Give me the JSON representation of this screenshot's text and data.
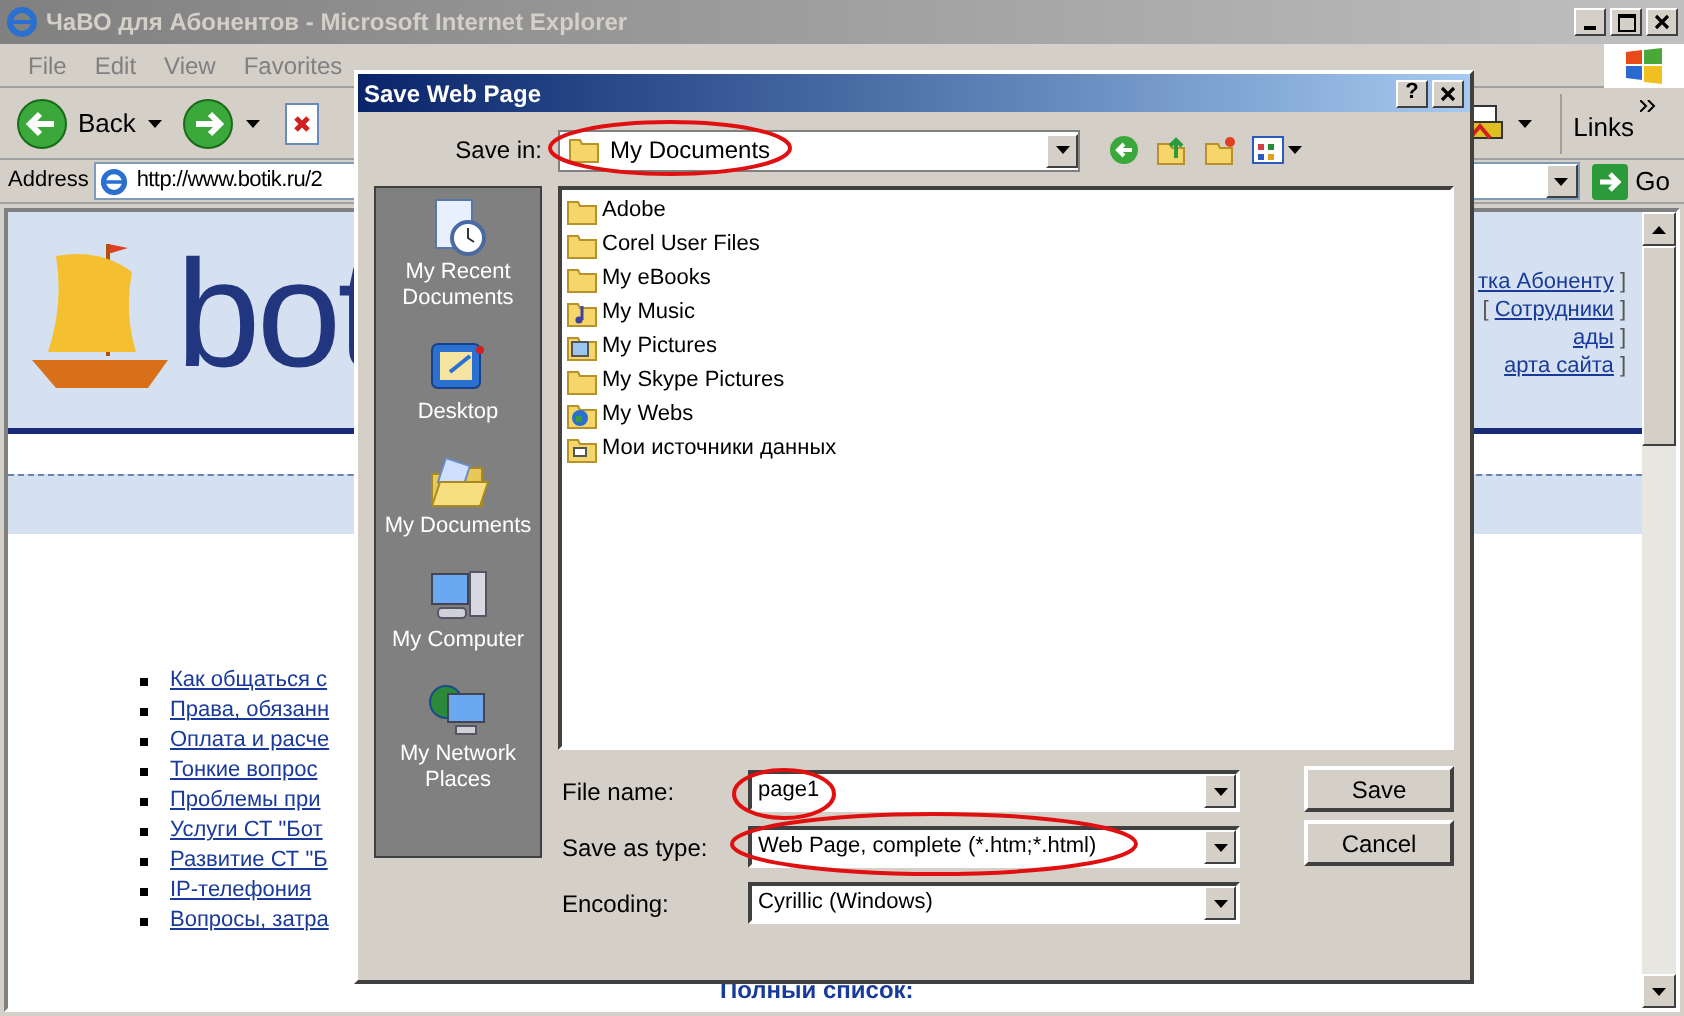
{
  "browser": {
    "title": "ЧаВО для Абонентов - Microsoft Internet Explorer",
    "menu": [
      "File",
      "Edit",
      "View",
      "Favorites"
    ],
    "toolbar": {
      "back": "Back",
      "links": "Links",
      "address_label": "Address",
      "address": "http://www.botik.ru/2",
      "go": "Go"
    }
  },
  "page": {
    "logo_text": "bot",
    "nav_lines": [
      [
        {
          "kind": "link",
          "text": "тка Абоненту"
        },
        {
          "kind": "plain",
          "text": "]"
        }
      ],
      [
        {
          "kind": "plain",
          "text": "["
        },
        {
          "kind": "link",
          "text": "Сотрудники"
        },
        {
          "kind": "plain",
          "text": "]"
        }
      ],
      [
        {
          "kind": "link",
          "text": "ады"
        },
        {
          "kind": "plain",
          "text": "]"
        }
      ],
      [
        {
          "kind": "link",
          "text": "арта сайта"
        },
        {
          "kind": "plain",
          "text": "]"
        }
      ]
    ],
    "faq": [
      "Как общаться с",
      "Права, обязанн",
      "Оплата и расче",
      "Тонкие вопрос",
      "Проблемы при",
      "Услуги СТ \"Бот",
      "Развитие СТ \"Б",
      "IP-телефония",
      "Вопросы, затра"
    ],
    "full_list": "Полный список:"
  },
  "dialog": {
    "title": "Save Web Page",
    "help": "?",
    "save_in_label": "Save in:",
    "save_in": "My Documents",
    "places": [
      {
        "kind": "recent",
        "label": "My Recent Documents"
      },
      {
        "kind": "desktop",
        "label": "Desktop"
      },
      {
        "kind": "documents",
        "label": "My Documents"
      },
      {
        "kind": "computer",
        "label": "My Computer"
      },
      {
        "kind": "network",
        "label": "My Network Places"
      }
    ],
    "files": [
      {
        "kind": "folder",
        "name": "Adobe"
      },
      {
        "kind": "folder",
        "name": "Corel User Files"
      },
      {
        "kind": "folder",
        "name": "My eBooks"
      },
      {
        "kind": "music",
        "name": "My Music"
      },
      {
        "kind": "pictures",
        "name": "My Pictures"
      },
      {
        "kind": "folder",
        "name": "My Skype Pictures"
      },
      {
        "kind": "webs",
        "name": "My Webs"
      },
      {
        "kind": "datasource",
        "name": "Мои источники данных"
      }
    ],
    "fields": [
      {
        "label": "File name:",
        "value": "page1"
      },
      {
        "label": "Save as type:",
        "value": "Web Page, complete (*.htm;*.html)"
      },
      {
        "label": "Encoding:",
        "value": "Cyrillic (Windows)"
      }
    ],
    "buttons": [
      "Save",
      "Cancel"
    ]
  }
}
